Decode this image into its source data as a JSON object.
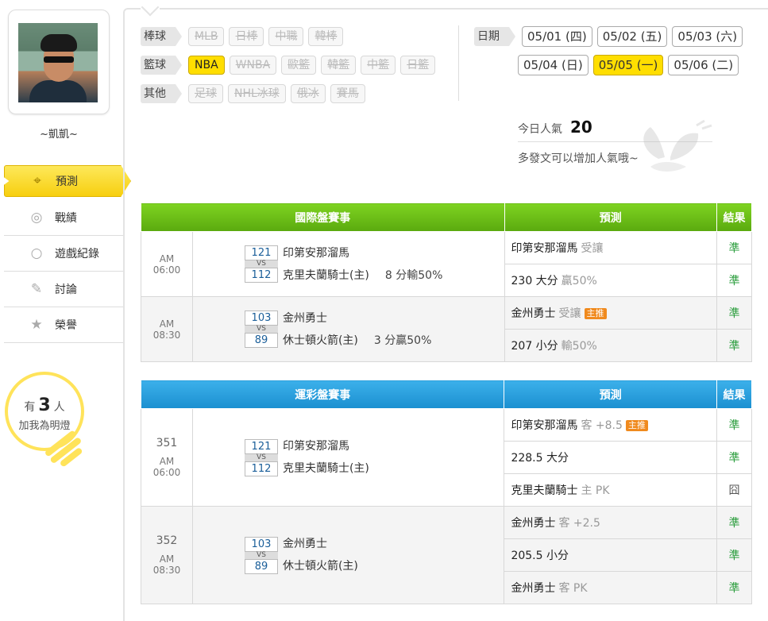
{
  "user": {
    "name": "~凱凱~"
  },
  "nav": [
    {
      "label": "預測",
      "icon": "target-icon"
    },
    {
      "label": "戰績",
      "icon": "chart-icon"
    },
    {
      "label": "遊戲紀錄",
      "icon": "circle-icon"
    },
    {
      "label": "討論",
      "icon": "chat-icon"
    },
    {
      "label": "榮譽",
      "icon": "star-icon"
    }
  ],
  "fans": {
    "prefix": "有",
    "count": "3",
    "suffix": "人",
    "line2": "加我為明燈"
  },
  "filters": {
    "baseball": {
      "label": "棒球",
      "items": [
        "MLB",
        "日棒",
        "中職",
        "韓棒"
      ]
    },
    "basketball": {
      "label": "籃球",
      "items": [
        "NBA",
        "WNBA",
        "歐籃",
        "韓籃",
        "中籃",
        "日籃"
      ]
    },
    "other": {
      "label": "其他",
      "items": [
        "足球",
        "NHL冰球",
        "俄冰",
        "賽馬"
      ]
    }
  },
  "dates": {
    "label": "日期",
    "items": [
      "05/01 (四)",
      "05/02 (五)",
      "05/03 (六)",
      "05/04 (日)",
      "05/05 (一)",
      "05/06 (二)"
    ]
  },
  "popularity": {
    "label": "今日人氣",
    "value": "20",
    "hint": "多發文可以增加人氣哦~"
  },
  "intl": {
    "headers": [
      "國際盤賽事",
      "預測",
      "結果"
    ],
    "games": [
      {
        "time": "AM 06:00",
        "away_score": "121",
        "home_score": "112",
        "vs": "VS",
        "away": "印第安那溜馬",
        "home": "克里夫蘭騎士(主)",
        "spread": "8 分輸50%",
        "picks": [
          {
            "main": "印第安那溜馬",
            "sub": "受讓",
            "tag": "",
            "result": "準"
          },
          {
            "main": "230 大分",
            "sub": "贏50%",
            "tag": "",
            "result": "準"
          }
        ]
      },
      {
        "time": "AM 08:30",
        "away_score": "103",
        "home_score": "89",
        "vs": "VS",
        "away": "金州勇士",
        "home": "休士頓火箭(主)",
        "spread": "3 分贏50%",
        "picks": [
          {
            "main": "金州勇士",
            "sub": "受讓",
            "tag": "主推",
            "result": "準"
          },
          {
            "main": "207 小分",
            "sub": "輸50%",
            "tag": "",
            "result": "準"
          }
        ]
      }
    ]
  },
  "lottery": {
    "headers": [
      "運彩盤賽事",
      "預測",
      "結果"
    ],
    "games": [
      {
        "no": "351",
        "time": "AM 06:00",
        "away_score": "121",
        "home_score": "112",
        "vs": "VS",
        "away": "印第安那溜馬",
        "home": "克里夫蘭騎士(主)",
        "picks": [
          {
            "main": "印第安那溜馬",
            "sub": "客 +8.5",
            "tag": "主推",
            "result": "準"
          },
          {
            "main": "228.5 大分",
            "sub": "",
            "tag": "",
            "result": "準"
          },
          {
            "main": "克里夫蘭騎士",
            "sub": "主 PK",
            "tag": "",
            "result": "囧"
          }
        ]
      },
      {
        "no": "352",
        "time": "AM 08:30",
        "away_score": "103",
        "home_score": "89",
        "vs": "VS",
        "away": "金州勇士",
        "home": "休士頓火箭(主)",
        "picks": [
          {
            "main": "金州勇士",
            "sub": "客 +2.5",
            "tag": "",
            "result": "準"
          },
          {
            "main": "205.5 小分",
            "sub": "",
            "tag": "",
            "result": "準"
          },
          {
            "main": "金州勇士",
            "sub": "客 PK",
            "tag": "",
            "result": "準"
          }
        ]
      }
    ]
  }
}
